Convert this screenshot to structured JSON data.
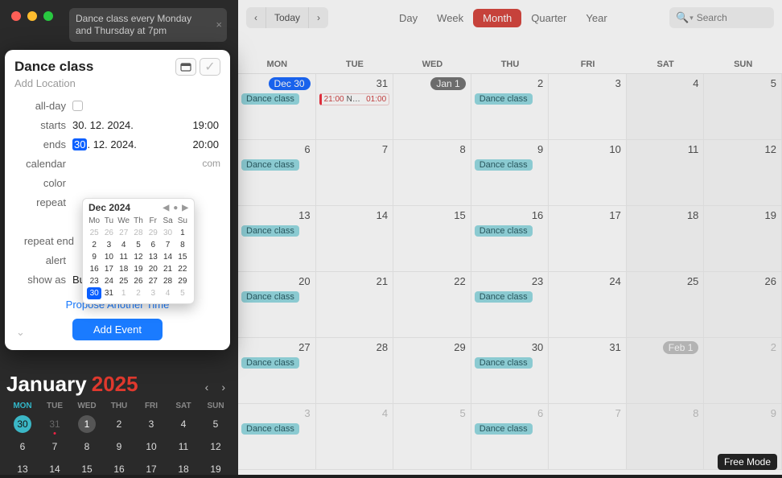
{
  "nl_query": "Dance class every Monday and Thursday at 7pm",
  "popover": {
    "title": "Dance class",
    "add_location": "Add Location",
    "labels": {
      "allday": "all-day",
      "starts": "starts",
      "ends": "ends",
      "calendar": "calendar",
      "color": "color",
      "repeat": "repeat",
      "repeat_end": "repeat end",
      "alert": "alert",
      "show_as": "show as"
    },
    "starts_date": "30. 12. 2024.",
    "starts_time": "19:00",
    "ends_d": "30",
    "ends_rest": ". 12. 2024.",
    "ends_time": "20:00",
    "calendar_suffix": "com",
    "show_as_value": "Busy",
    "propose": "Propose Another Time",
    "add_event": "Add Event"
  },
  "dpicker": {
    "title": "Dec 2024",
    "dow": [
      "Mo",
      "Tu",
      "We",
      "Th",
      "Fr",
      "Sa",
      "Su"
    ],
    "cells": [
      {
        "n": "25",
        "o": true
      },
      {
        "n": "26",
        "o": true
      },
      {
        "n": "27",
        "o": true
      },
      {
        "n": "28",
        "o": true
      },
      {
        "n": "29",
        "o": true
      },
      {
        "n": "30",
        "o": true
      },
      {
        "n": "1"
      },
      {
        "n": "2"
      },
      {
        "n": "3"
      },
      {
        "n": "4"
      },
      {
        "n": "5"
      },
      {
        "n": "6"
      },
      {
        "n": "7"
      },
      {
        "n": "8"
      },
      {
        "n": "9"
      },
      {
        "n": "10"
      },
      {
        "n": "11"
      },
      {
        "n": "12"
      },
      {
        "n": "13"
      },
      {
        "n": "14"
      },
      {
        "n": "15"
      },
      {
        "n": "16"
      },
      {
        "n": "17"
      },
      {
        "n": "18"
      },
      {
        "n": "19"
      },
      {
        "n": "20"
      },
      {
        "n": "21"
      },
      {
        "n": "22"
      },
      {
        "n": "23"
      },
      {
        "n": "24"
      },
      {
        "n": "25"
      },
      {
        "n": "26"
      },
      {
        "n": "27"
      },
      {
        "n": "28"
      },
      {
        "n": "29"
      },
      {
        "n": "30",
        "sel": true,
        "box": true
      },
      {
        "n": "31"
      },
      {
        "n": "1",
        "o": true
      },
      {
        "n": "2",
        "o": true
      },
      {
        "n": "3",
        "o": true
      },
      {
        "n": "4",
        "o": true
      },
      {
        "n": "5",
        "o": true
      }
    ]
  },
  "dark_month": {
    "month": "January",
    "year": "2025",
    "dow": [
      "MON",
      "TUE",
      "WED",
      "THU",
      "FRI",
      "SAT",
      "SUN"
    ],
    "cells": [
      {
        "n": "30",
        "today": true
      },
      {
        "n": "31",
        "oth": true,
        "dot": true
      },
      {
        "n": "1",
        "sel": true
      },
      {
        "n": "2"
      },
      {
        "n": "3"
      },
      {
        "n": "4"
      },
      {
        "n": "5"
      },
      {
        "n": "6"
      },
      {
        "n": "7"
      },
      {
        "n": "8"
      },
      {
        "n": "9"
      },
      {
        "n": "10"
      },
      {
        "n": "11"
      },
      {
        "n": "12"
      },
      {
        "n": "13"
      },
      {
        "n": "14"
      },
      {
        "n": "15"
      },
      {
        "n": "16"
      },
      {
        "n": "17"
      },
      {
        "n": "18"
      },
      {
        "n": "19"
      }
    ]
  },
  "toolbar": {
    "today": "Today",
    "views": [
      "Day",
      "Week",
      "Month",
      "Quarter",
      "Year"
    ],
    "active_view": "Month",
    "search_placeholder": "Search"
  },
  "dow": [
    "MON",
    "TUE",
    "WED",
    "THU",
    "FRI",
    "SAT",
    "SUN"
  ],
  "event_label": "Dance class",
  "nye": {
    "time1": "21:00",
    "text": "New Year's Eve P…",
    "time2": "01:00"
  },
  "badges": {
    "dec30": "Dec 30",
    "jan1": "Jan 1",
    "feb1": "Feb 1"
  },
  "free_mode": "Free Mode",
  "grid_rows": [
    [
      {
        "badge": "dec30",
        "cls": "cur",
        "ev": "dance"
      },
      {
        "num": "31",
        "ev": "nye"
      },
      {
        "badge": "jan1",
        "cls": "jan1"
      },
      {
        "num": "2",
        "ev": "dance"
      },
      {
        "num": "3"
      },
      {
        "num": "4"
      },
      {
        "num": "5"
      }
    ],
    [
      {
        "num": "6",
        "ev": "dance"
      },
      {
        "num": "7"
      },
      {
        "num": "8"
      },
      {
        "num": "9",
        "ev": "dance"
      },
      {
        "num": "10"
      },
      {
        "num": "11"
      },
      {
        "num": "12"
      }
    ],
    [
      {
        "num": "13",
        "ev": "dance"
      },
      {
        "num": "14"
      },
      {
        "num": "15"
      },
      {
        "num": "16",
        "ev": "dance"
      },
      {
        "num": "17"
      },
      {
        "num": "18"
      },
      {
        "num": "19"
      }
    ],
    [
      {
        "num": "20",
        "ev": "dance"
      },
      {
        "num": "21"
      },
      {
        "num": "22"
      },
      {
        "num": "23",
        "ev": "dance"
      },
      {
        "num": "24"
      },
      {
        "num": "25"
      },
      {
        "num": "26"
      }
    ],
    [
      {
        "num": "27",
        "ev": "dance"
      },
      {
        "num": "28"
      },
      {
        "num": "29"
      },
      {
        "num": "30",
        "ev": "dance"
      },
      {
        "num": "31"
      },
      {
        "badge": "feb1",
        "cls": "feb1",
        "oth": true
      },
      {
        "num": "2",
        "oth": true
      }
    ],
    [
      {
        "num": "3",
        "ev": "dance",
        "oth": true
      },
      {
        "num": "4",
        "oth": true
      },
      {
        "num": "5",
        "oth": true
      },
      {
        "num": "6",
        "ev": "dance",
        "oth": true
      },
      {
        "num": "7",
        "oth": true
      },
      {
        "num": "8",
        "oth": true
      },
      {
        "num": "9",
        "oth": true
      }
    ]
  ]
}
